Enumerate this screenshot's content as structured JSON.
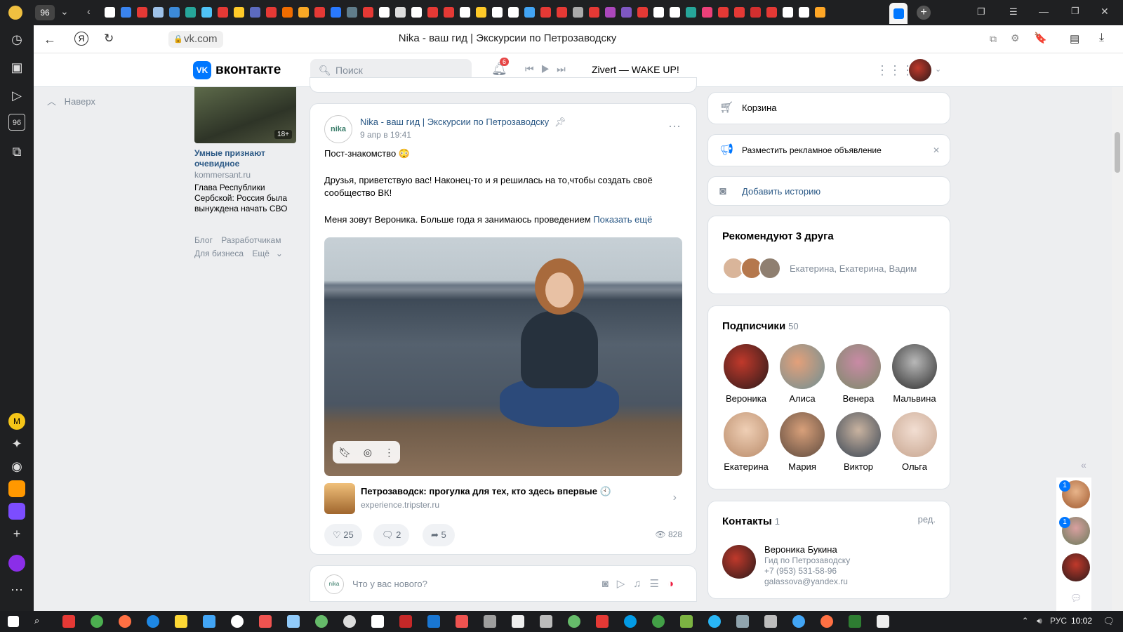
{
  "browser": {
    "tab_counter": "96",
    "url": "vk.com",
    "page_title": "Nika - ваш гид | Экскурсии по Петрозаводску",
    "sidebar_counter": "96"
  },
  "vk_header": {
    "logo_text": "вконтакте",
    "search_placeholder": "Поиск",
    "notif_count": "6",
    "track": "Zivert — WAKE UP!"
  },
  "left": {
    "nav_up": "Наверх",
    "ad": {
      "age": "18+",
      "title": "Умные признают очевидное",
      "source": "kommersant.ru",
      "text": "Глава Республики Сербской: Россия была вынуждена начать СВО"
    },
    "footer": [
      "Блог",
      "Разработчикам",
      "Для бизнеса",
      "Ещё"
    ]
  },
  "post": {
    "avatar_text": "nika",
    "author": "Nika - ваш гид | Экскурсии по Петрозаводску",
    "date": "9 апр в 19:41",
    "paragraph1": "Пост-знакомство 😳",
    "paragraph2": "Друзья, приветствую вас! Наконец-то и я решилась на то,чтобы создать своё сообщество ВК!",
    "paragraph3": "Меня зовут Вероника. Больше года я занимаюсь проведением",
    "show_more": "Показать ещё",
    "snippet_title": "Петрозаводск: прогулка для тех, кто здесь впервые 🕙",
    "snippet_domain": "experience.tripster.ru",
    "likes": "25",
    "comments": "2",
    "shares": "5",
    "views": "828"
  },
  "new_post": {
    "placeholder": "Что у вас нового?"
  },
  "right": {
    "cart": "Корзина",
    "ad_place": "Разместить рекламное объявление",
    "add_story": "Добавить историю",
    "recommend_title": "Рекомендуют 3 друга",
    "recommend_names": "Екатерина, Екатерина, Вадим",
    "subscribers_title": "Подписчики",
    "subscribers_count": "50",
    "subscribers": [
      "Вероника",
      "Алиса",
      "Венера",
      "Мальвина",
      "Екатерина",
      "Мария",
      "Виктор",
      "Ольга"
    ],
    "contacts_title": "Контакты",
    "contacts_count": "1",
    "contacts_edit": "ред.",
    "contact_name": "Вероника Букина",
    "contact_role": "Гид по Петрозаводску",
    "contact_phone": "+7 (953) 531-58-96",
    "contact_email": "galassova@yandex.ru"
  },
  "right_strip": {
    "badge1": "1",
    "badge2": "1"
  },
  "taskbar": {
    "lang": "РУС",
    "time": "10:02"
  },
  "colors": {
    "vk_blue": "#0077ff",
    "link": "#2a5885",
    "muted": "#818c99",
    "badge_red": "#e64646"
  }
}
